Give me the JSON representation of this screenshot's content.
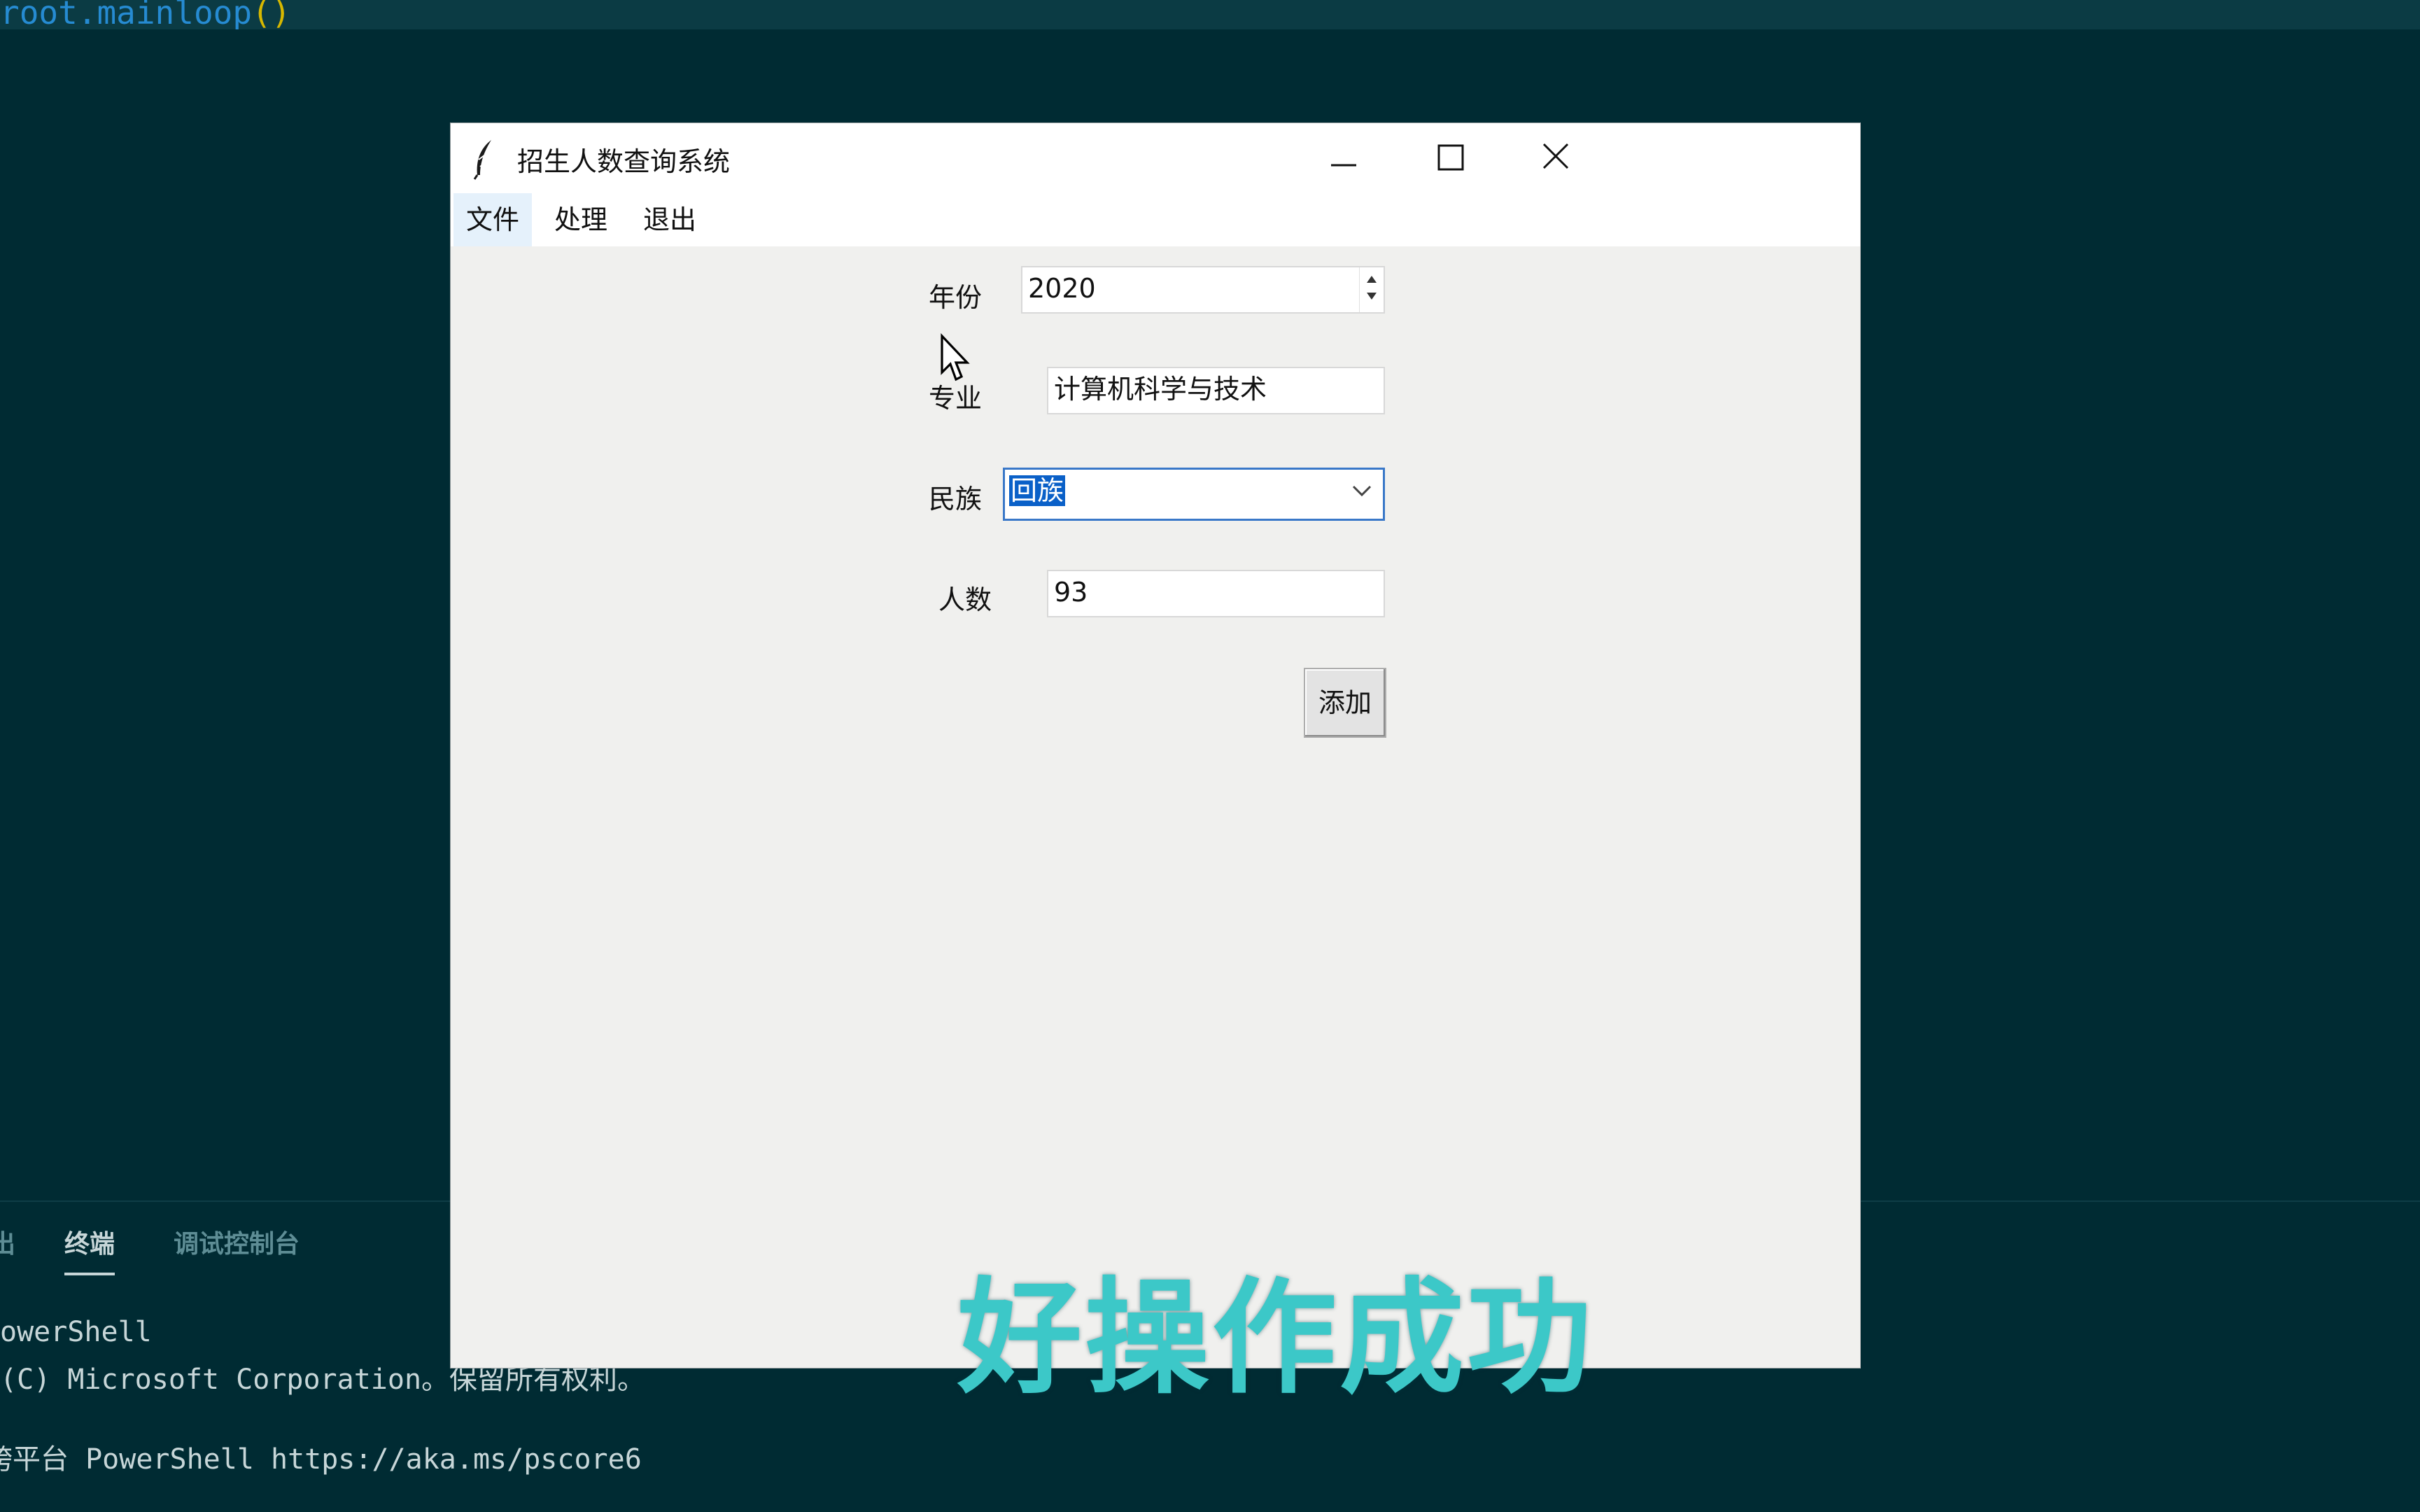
{
  "editor": {
    "code_prefix": "root.mainloop",
    "code_parens": "()"
  },
  "panel": {
    "tabs": [
      {
        "label": "出"
      },
      {
        "label": "终端"
      },
      {
        "label": "调试控制台"
      }
    ],
    "terminal_lines": [
      "owerShell",
      "(C) Microsoft Corporation。保留所有权利。",
      "跨平台 PowerShell https://aka.ms/pscore6"
    ]
  },
  "window": {
    "title": "招生人数查询系统",
    "controls": {
      "minimize": "minimize",
      "maximize": "maximize",
      "close": "close"
    }
  },
  "menu": {
    "items": [
      {
        "label": "文件"
      },
      {
        "label": "处理"
      },
      {
        "label": "退出"
      }
    ]
  },
  "form": {
    "year": {
      "label": "年份",
      "value": "2020"
    },
    "major": {
      "label": "专业",
      "value": "计算机科学与技术"
    },
    "ethnicity": {
      "label": "民族",
      "value": "回族"
    },
    "count": {
      "label": "人数",
      "value": "93"
    },
    "add_button": "添加"
  },
  "overlay_caption": "好操作成功",
  "colors": {
    "editor_bg": "#002b33",
    "window_bg": "#f0f0ee",
    "caption": "#3cc8c8",
    "selection": "#0a60c8"
  }
}
